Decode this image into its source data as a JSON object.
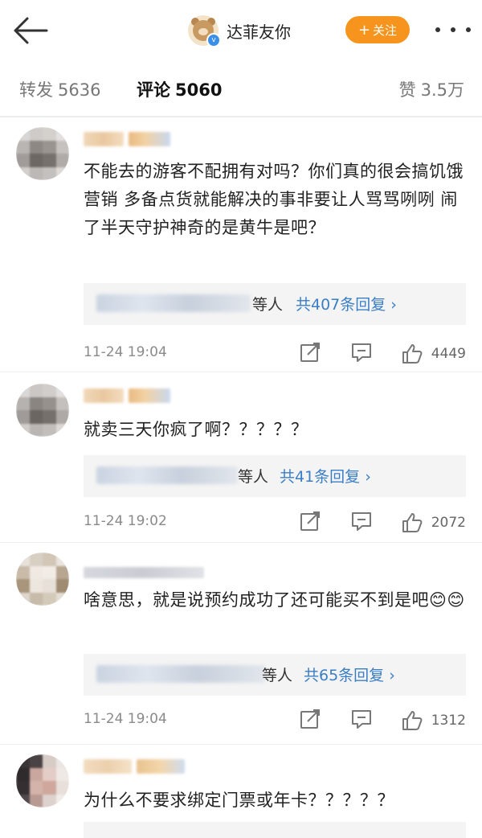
{
  "header": {
    "user_name": "达菲友你",
    "verified_badge": "v",
    "follow_label": "关注",
    "follow_plus": "+"
  },
  "tabs": {
    "repost_label": "转发",
    "repost_count": "5636",
    "comment_label": "评论",
    "comment_count": "5060",
    "like_label": "赞",
    "like_count": "3.5万"
  },
  "colors": {
    "follow_bg": "#f7941d",
    "link_blue": "#3a7ec6",
    "time_gray": "#8a8a8a"
  },
  "comments": [
    {
      "text": "不能去的游客不配拥有对吗？你们真的很会搞饥饿营销 多备点货就能解决的事非要让人骂骂咧咧 闹了半天守护神奇的是黄牛是吧？",
      "reply_suffix": "等人",
      "reply_count": "共407条回复 ›",
      "time": "11-24 19:04",
      "likes": "4449"
    },
    {
      "text": "就卖三天你疯了啊？？？？？",
      "reply_suffix": "等人",
      "reply_count": "共41条回复 ›",
      "time": "11-24 19:02",
      "likes": "2072"
    },
    {
      "text": "啥意思，就是说预约成功了还可能买不到是吧😊😊",
      "reply_suffix": "等人",
      "reply_count": "共65条回复 ›",
      "time": "11-24 19:04",
      "likes": "1312"
    },
    {
      "text": "为什么不要求绑定门票或年卡？？？？？",
      "reply_suffix": "",
      "reply_count": "",
      "time": "",
      "likes": ""
    }
  ],
  "icons": {
    "back": "back-arrow-icon",
    "more": "more-dots-icon",
    "share": "share-icon",
    "comment": "comment-icon",
    "like": "thumbs-up-icon"
  }
}
